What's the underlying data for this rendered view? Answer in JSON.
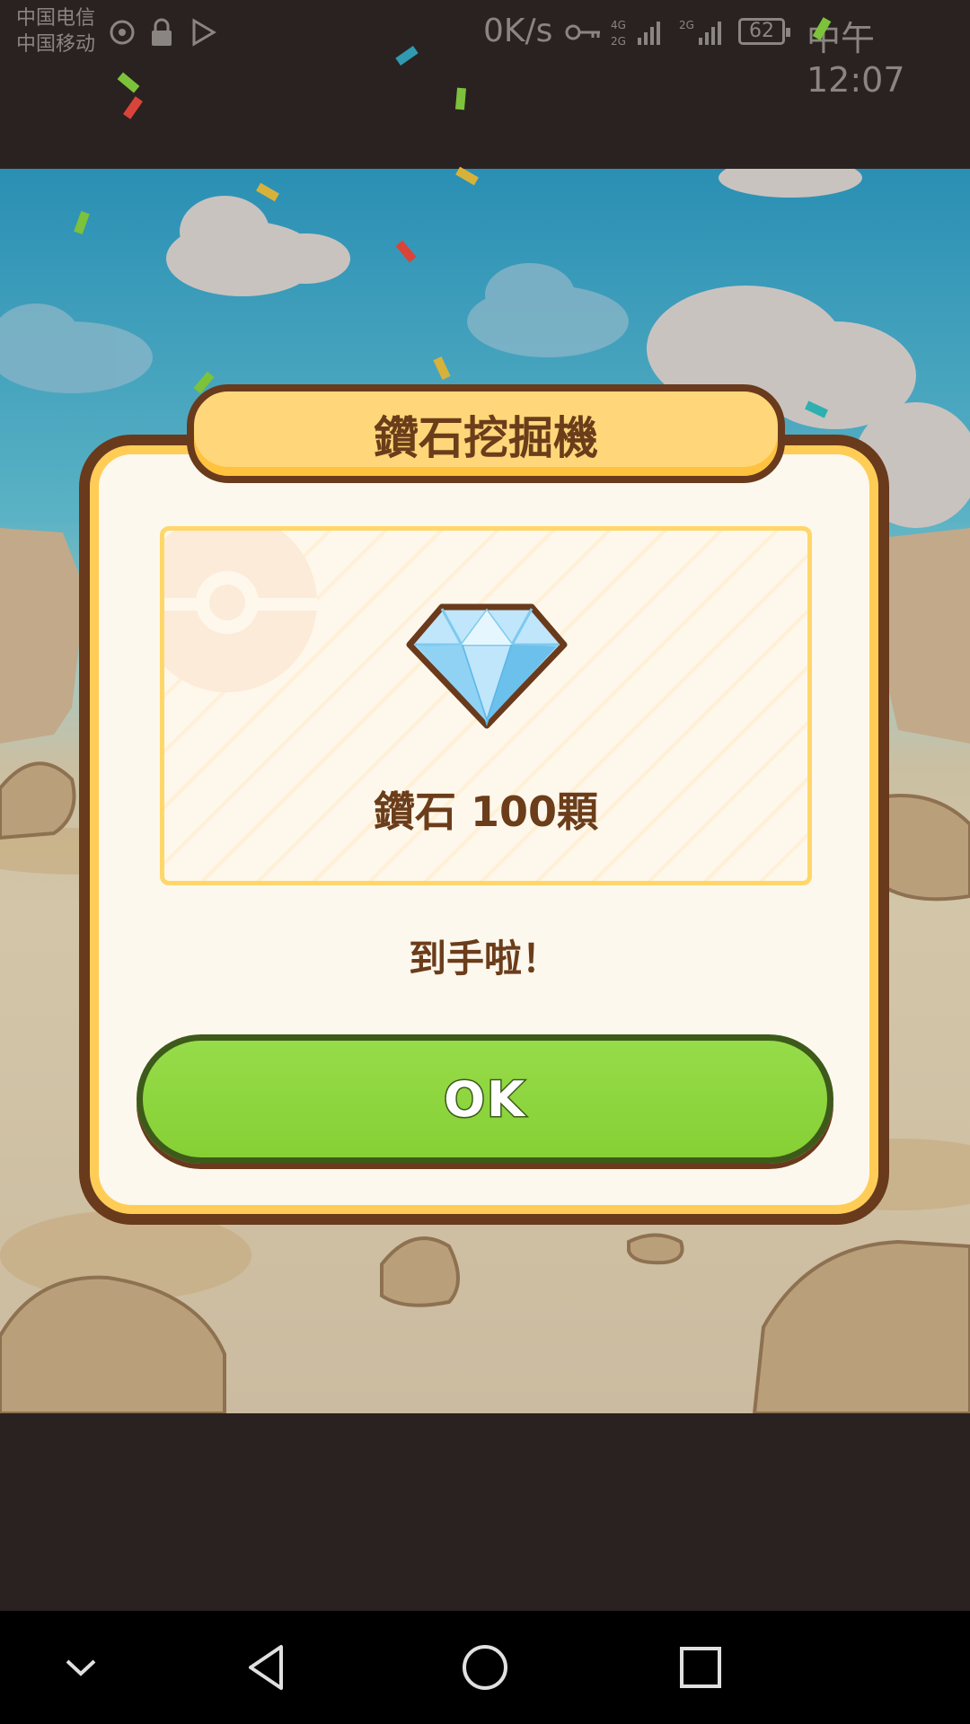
{
  "status_bar": {
    "carrier_1": "中国电信",
    "carrier_2": "中国移动",
    "net_speed": "0K/s",
    "battery": "62",
    "time": "中午12:07",
    "icons": [
      "wifi-hotspot-icon",
      "lock-icon",
      "play-store-icon",
      "key-icon",
      "signal-4g-icon",
      "signal-2g-icon",
      "battery-icon"
    ]
  },
  "dialog": {
    "title": "鑽石挖掘機",
    "reward_label": "鑽石 100顆",
    "message": "到手啦！",
    "ok_label": "OK"
  },
  "nav_bar": {
    "icons": [
      "collapse-icon",
      "back-icon",
      "home-icon",
      "recents-icon"
    ]
  },
  "colors": {
    "dialog_border": "#6a3a1c",
    "dialog_accent": "#ffcd55",
    "text_brown": "#6b3d1a",
    "ok_green": "#8ad53c"
  }
}
